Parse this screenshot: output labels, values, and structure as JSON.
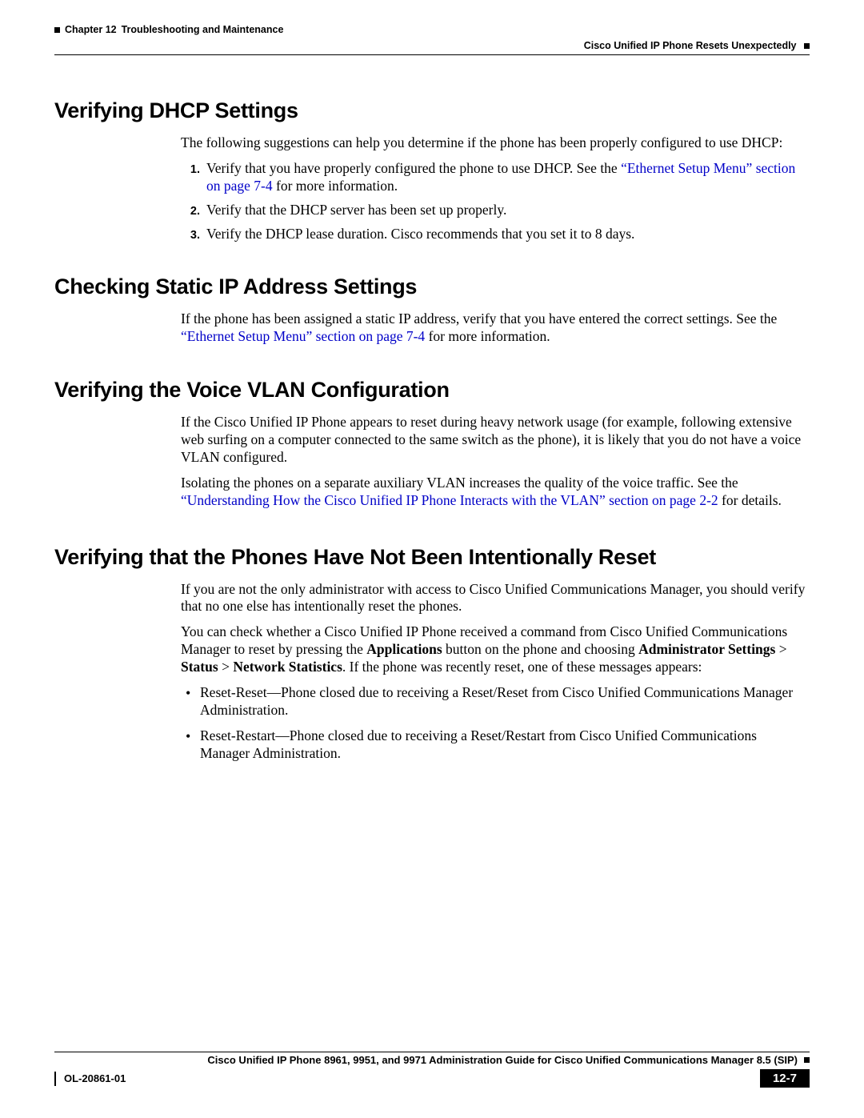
{
  "header": {
    "chapter_label": "Chapter 12",
    "chapter_title": "Troubleshooting and Maintenance",
    "section_title": "Cisco Unified IP Phone Resets Unexpectedly"
  },
  "sections": {
    "dhcp": {
      "heading": "Verifying DHCP Settings",
      "intro": "The following suggestions can help you determine if the phone has been properly configured to use DHCP:",
      "item1_pre": "Verify that you have properly configured the phone to use DHCP. See the ",
      "item1_link": "“Ethernet Setup Menu” section on page 7-4",
      "item1_post": " for more information.",
      "item2": "Verify that the DHCP server has been set up properly.",
      "item3": "Verify the DHCP lease duration. Cisco recommends that you set it to 8 days."
    },
    "static_ip": {
      "heading": "Checking Static IP Address Settings",
      "para_pre": "If the phone has been assigned a static IP address, verify that you have entered the correct settings. See the ",
      "para_link": "“Ethernet Setup Menu” section on page 7-4",
      "para_post": " for more information."
    },
    "vlan": {
      "heading": "Verifying the Voice VLAN Configuration",
      "para1": "If the Cisco Unified IP Phone appears to reset during heavy network usage (for example, following extensive web surfing on a computer connected to the same switch as the phone), it is likely that you do not have a voice VLAN configured.",
      "para2_pre": "Isolating the phones on a separate auxiliary VLAN increases the quality of the voice traffic. See the ",
      "para2_link": "“Understanding How the Cisco Unified IP Phone Interacts with the VLAN” section on page 2-2",
      "para2_post": " for details."
    },
    "reset": {
      "heading": "Verifying that the Phones Have Not Been Intentionally Reset",
      "para1": "If you are not the only administrator with access to Cisco Unified Communications Manager, you should verify that no one else has intentionally reset the phones.",
      "para2_a": "You can check whether a Cisco Unified IP Phone received a command from Cisco Unified Communications Manager to reset by pressing the ",
      "para2_b": "Applications",
      "para2_c": " button on the phone and choosing ",
      "para2_d": "Administrator Settings",
      "para2_e": " > ",
      "para2_f": "Status",
      "para2_g": " > ",
      "para2_h": "Network Statistics",
      "para2_i": ". If the phone was recently reset, one of these messages appears:",
      "bullet1": "Reset-Reset—Phone closed due to receiving a Reset/Reset from Cisco Unified Communications Manager Administration.",
      "bullet2": "Reset-Restart—Phone closed due to receiving a Reset/Restart from Cisco Unified Communications Manager Administration."
    }
  },
  "footer": {
    "guide_title": "Cisco Unified IP Phone 8961, 9951, and 9971 Administration Guide for Cisco Unified Communications Manager 8.5 (SIP)",
    "doc_number": "OL-20861-01",
    "page_number": "12-7"
  }
}
